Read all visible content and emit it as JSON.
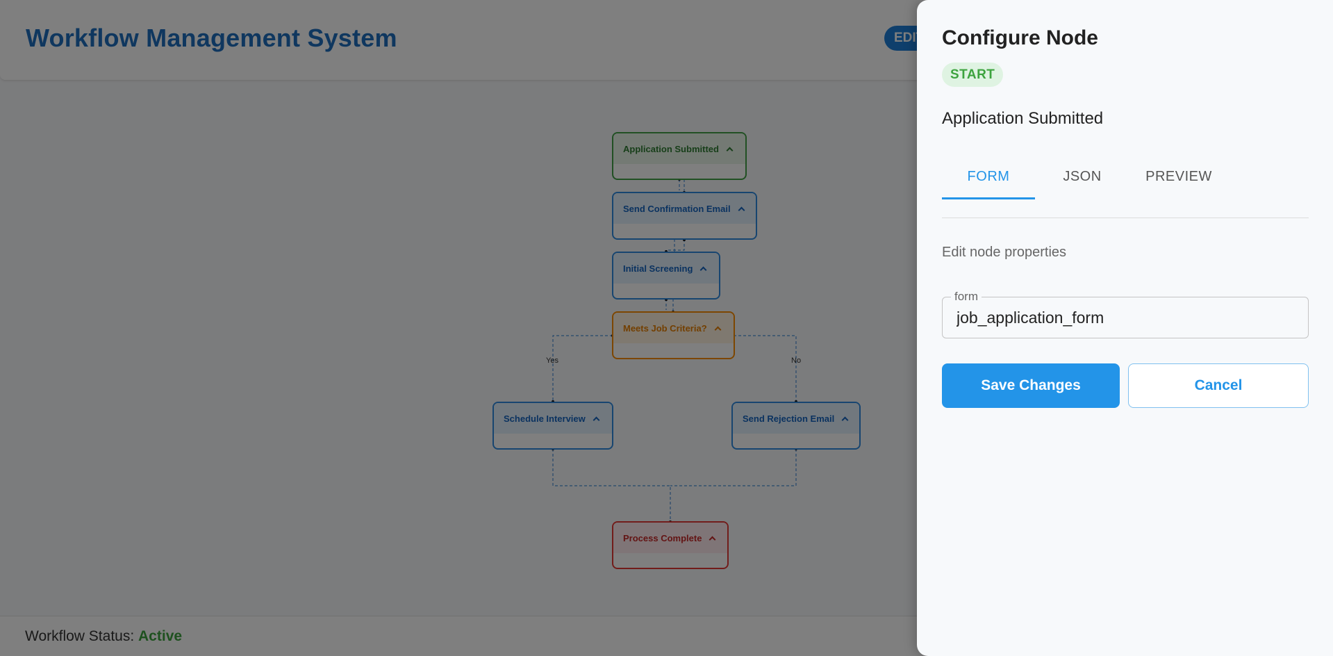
{
  "header": {
    "title": "Workflow Management System",
    "edit_label": "EDIT"
  },
  "workflow": {
    "nodes": [
      {
        "id": "application-submitted",
        "label": "Application Submitted",
        "type": "start"
      },
      {
        "id": "send-confirmation-email",
        "label": "Send Confirmation Email",
        "type": "action"
      },
      {
        "id": "initial-screening",
        "label": "Initial Screening",
        "type": "action"
      },
      {
        "id": "meets-job-criteria",
        "label": "Meets Job Criteria?",
        "type": "decision"
      },
      {
        "id": "schedule-interview",
        "label": "Schedule Interview",
        "type": "action"
      },
      {
        "id": "send-rejection-email",
        "label": "Send Rejection Email",
        "type": "action"
      },
      {
        "id": "process-complete",
        "label": "Process Complete",
        "type": "end"
      }
    ],
    "edge_labels": {
      "yes": "Yes",
      "no": "No"
    }
  },
  "footer": {
    "status_label": "Workflow Status:",
    "status_value": "Active"
  },
  "drawer": {
    "title": "Configure Node",
    "chip": "START",
    "node_name": "Application Submitted",
    "tabs": [
      {
        "label": "FORM",
        "active": true
      },
      {
        "label": "JSON",
        "active": false
      },
      {
        "label": "PREVIEW",
        "active": false
      }
    ],
    "hint": "Edit node properties",
    "field": {
      "label": "form",
      "value": "job_application_form"
    },
    "save_label": "Save Changes",
    "cancel_label": "Cancel"
  },
  "colors": {
    "accent": "#2394e8",
    "start": "#43a047",
    "action": "#2f8be0",
    "decision": "#fb8c00",
    "end": "#e53935",
    "status_active": "#3da33f"
  }
}
